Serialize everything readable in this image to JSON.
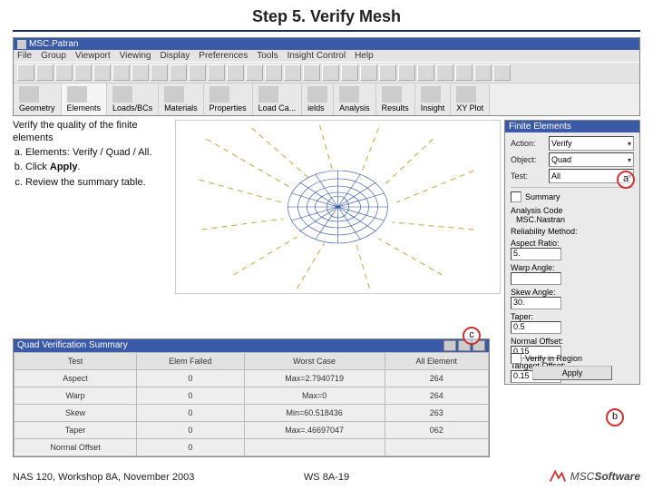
{
  "title": "Step 5. Verify Mesh",
  "app": {
    "title": "MSC.Patran"
  },
  "menu": [
    "File",
    "Group",
    "Viewport",
    "Viewing",
    "Display",
    "Preferences",
    "Tools",
    "Insight Control",
    "Help"
  ],
  "tabs": [
    "Geometry",
    "Elements",
    "Loads/BCs",
    "Materials",
    "Properties",
    "Load Ca...",
    "ields",
    "Analysis",
    "Results",
    "Insight",
    "XY Plot"
  ],
  "instr": {
    "intro": "Verify the quality of the finite elements",
    "items": [
      "Elements: Verify / Quad / All.",
      "Click Apply.",
      "Review the summary table."
    ],
    "apply_word": "Apply"
  },
  "fe": {
    "title": "Finite Elements",
    "labels": {
      "action": "Action:",
      "object": "Object:",
      "test": "Test:"
    },
    "action": "Verify",
    "object": "Quad",
    "test": "All",
    "summary": "Summary",
    "analysis_code_label": "Analysis Code",
    "analysis_code": "MSC.Nastran",
    "method_label": "Reliability Method:",
    "aspect_label": "Aspect Ratio:",
    "aspect": "5.",
    "warp_label": "Warp Angle:",
    "warp": "",
    "skew_label": "Skew Angle:",
    "skew": "30.",
    "taper_label": "Taper:",
    "taper": "0.5",
    "normal_label": "Normal Offset:",
    "normal": "0.15",
    "tangent_label": "Tangent Offset:",
    "tangent": "0.15",
    "verify_label": "Verify in Region",
    "apply": "Apply"
  },
  "marks": {
    "a": "a",
    "b": "b",
    "c": "c"
  },
  "summary": {
    "title": "Quad Verification Summary",
    "headers": [
      "Test",
      "Elem Failed",
      "Worst Case",
      "All Element"
    ],
    "rows": [
      [
        "Aspect",
        "0",
        "Max=2.7940719",
        "264"
      ],
      [
        "Warp",
        "0",
        "Max=0",
        "264"
      ],
      [
        "Skew",
        "0",
        "Min=60.518436",
        "263"
      ],
      [
        "Taper",
        "0",
        "Max=.46697047",
        "062"
      ],
      [
        "Normal Offset",
        "0",
        "",
        ""
      ]
    ]
  },
  "footer": {
    "left": "NAS 120, Workshop 8A, November 2003",
    "center": "WS 8A-19",
    "logo_prefix": "MSC",
    "logo_suffix": "Software"
  }
}
